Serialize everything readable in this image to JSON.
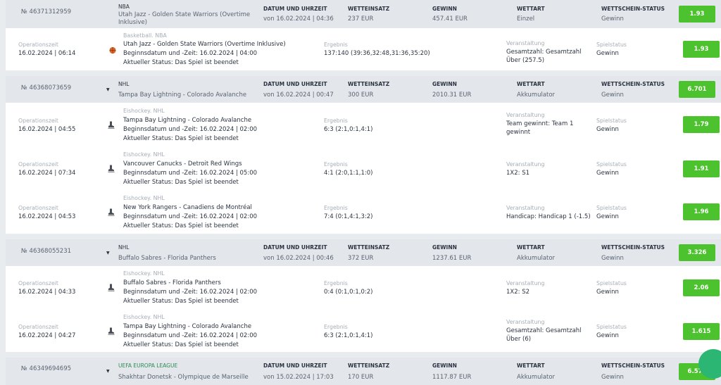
{
  "column_labels": {
    "date": "DATUM UND UHRZEIT",
    "stake": "WETTEINSATZ",
    "win": "GEWINN",
    "type": "WETTART",
    "status": "WETTSCHEIN-STATUS"
  },
  "leg_labels": {
    "op_time": "Operationszeit",
    "result": "Ergebnis",
    "event": "Veranstaltung",
    "game_status": "Spielstatus"
  },
  "colors": {
    "coef_bg": "#4cc22e",
    "header_bg": "#e3e6ea",
    "leg_bg": "#ffffff",
    "league_green": "#2e8b57"
  },
  "bets": [
    {
      "number": "№ 46371312959",
      "league": "NBA",
      "match": "Utah Jazz - Golden State Warriors (Overtime Inklusive)",
      "match_line1": "Utah Jazz - Golden State Warriors (Overtime",
      "match_line2": "Inklusive)",
      "datetime": "von 16.02.2024 | 04:36",
      "stake": "237 EUR",
      "win": "457.41 EUR",
      "type": "Einzel",
      "status": "Gewinn",
      "coef": "1.93",
      "legs": [
        {
          "op_time": "16.02.2024 | 06:14",
          "sport": "Basketball. NBA",
          "sport_icon": "basketball-icon",
          "match": "Utah Jazz - Golden State Warriors (Overtime Inklusive)",
          "start": "Beginnsdatum und -Zeit: 16.02.2024 | 04:00",
          "current": "Aktueller Status: Das Spiel ist beendet",
          "result": "137:140 (39:36,32:48,31:36,35:20)",
          "event": "Gesamtzahl: Gesamtzahl Über (257.5)",
          "game_status": "Gewinn",
          "coef": "1.93"
        }
      ]
    },
    {
      "number": "№ 46368073659",
      "league": "NHL",
      "match": "Tampa Bay Lightning - Colorado Avalanche",
      "datetime": "von 16.02.2024 | 00:47",
      "stake": "300 EUR",
      "win": "2010.31 EUR",
      "type": "Akkumulator",
      "status": "Gewinn",
      "coef": "6.701",
      "legs": [
        {
          "op_time": "16.02.2024 | 04:55",
          "sport": "Eishockey. NHL",
          "sport_icon": "hockey-skate-icon",
          "match": "Tampa Bay Lightning - Colorado Avalanche",
          "start": "Beginnsdatum und -Zeit: 16.02.2024 | 02:00",
          "current": "Aktueller Status: Das Spiel ist beendet",
          "result": "6:3 (2:1,0:1,4:1)",
          "event": "Team gewinnt: Team 1 gewinnt",
          "game_status": "Gewinn",
          "coef": "1.79"
        },
        {
          "op_time": "16.02.2024 | 07:34",
          "sport": "Eishockey. NHL",
          "sport_icon": "hockey-skate-icon",
          "match": "Vancouver Canucks - Detroit Red Wings",
          "start": "Beginnsdatum und -Zeit: 16.02.2024 | 05:00",
          "current": "Aktueller Status: Das Spiel ist beendet",
          "result": "4:1 (2:0,1:1,1:0)",
          "event": "1X2: S1",
          "game_status": "Gewinn",
          "coef": "1.91"
        },
        {
          "op_time": "16.02.2024 | 04:53",
          "sport": "Eishockey. NHL",
          "sport_icon": "hockey-skate-icon",
          "match": "New York Rangers - Canadiens de Montréal",
          "start": "Beginnsdatum und -Zeit: 16.02.2024 | 02:00",
          "current": "Aktueller Status: Das Spiel ist beendet",
          "result": "7:4 (0:1,4:1,3:2)",
          "event": "Handicap: Handicap 1 (-1.5)",
          "game_status": "Gewinn",
          "coef": "1.96"
        }
      ]
    },
    {
      "number": "№ 46368055231",
      "league": "NHL",
      "match": "Buffalo Sabres - Florida Panthers",
      "datetime": "von 16.02.2024 | 00:46",
      "stake": "372 EUR",
      "win": "1237.61 EUR",
      "type": "Akkumulator",
      "status": "Gewinn",
      "coef": "3.326",
      "legs": [
        {
          "op_time": "16.02.2024 | 04:33",
          "sport": "Eishockey. NHL",
          "sport_icon": "hockey-skate-icon",
          "match": "Buffalo Sabres - Florida Panthers",
          "start": "Beginnsdatum und -Zeit: 16.02.2024 | 02:00",
          "current": "Aktueller Status: Das Spiel ist beendet",
          "result": "0:4 (0:1,0:1,0:2)",
          "event": "1X2: S2",
          "game_status": "Gewinn",
          "coef": "2.06"
        },
        {
          "op_time": "16.02.2024 | 04:27",
          "sport": "Eishockey. NHL",
          "sport_icon": "hockey-skate-icon",
          "match": "Tampa Bay Lightning - Colorado Avalanche",
          "start": "Beginnsdatum und -Zeit: 16.02.2024 | 02:00",
          "current": "Aktueller Status: Das Spiel ist beendet",
          "result": "6:3 (2:1,0:1,4:1)",
          "event": "Gesamtzahl: Gesamtzahl Über (6)",
          "game_status": "Gewinn",
          "coef": "1.615"
        }
      ]
    },
    {
      "number": "№ 46349694695",
      "league": "UEFA EUROPA LEAGUE",
      "match": "Shakhtar Donetsk - Olympique de Marseille",
      "datetime": "von 15.02.2024 | 17:03",
      "stake": "170 EUR",
      "win": "1117.87 EUR",
      "type": "Akkumulator",
      "status": "Gewinn",
      "coef": "6.575",
      "legs": []
    }
  ]
}
